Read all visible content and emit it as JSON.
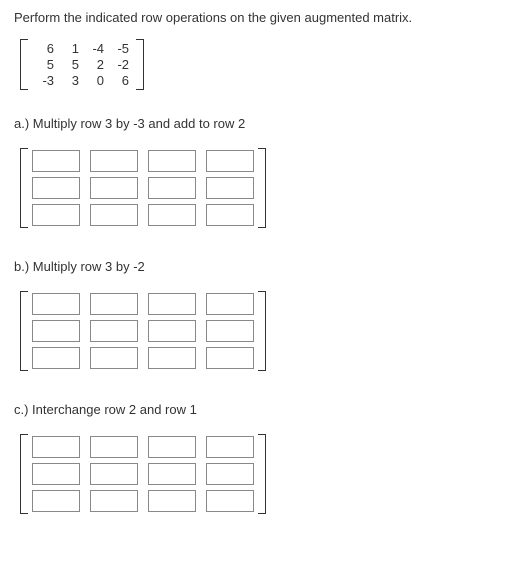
{
  "instruction": "Perform the indicated row operations on the given augmented matrix.",
  "matrix": [
    [
      "6",
      "1",
      "-4",
      "-5"
    ],
    [
      "5",
      "5",
      "2",
      "-2"
    ],
    [
      "-3",
      "3",
      "0",
      "6"
    ]
  ],
  "parts": [
    {
      "label": "a.) Multiply row 3 by -3 and add to row 2"
    },
    {
      "label": "b.) Multiply row 3 by -2"
    },
    {
      "label": "c.) Interchange row 2 and row 1"
    }
  ]
}
